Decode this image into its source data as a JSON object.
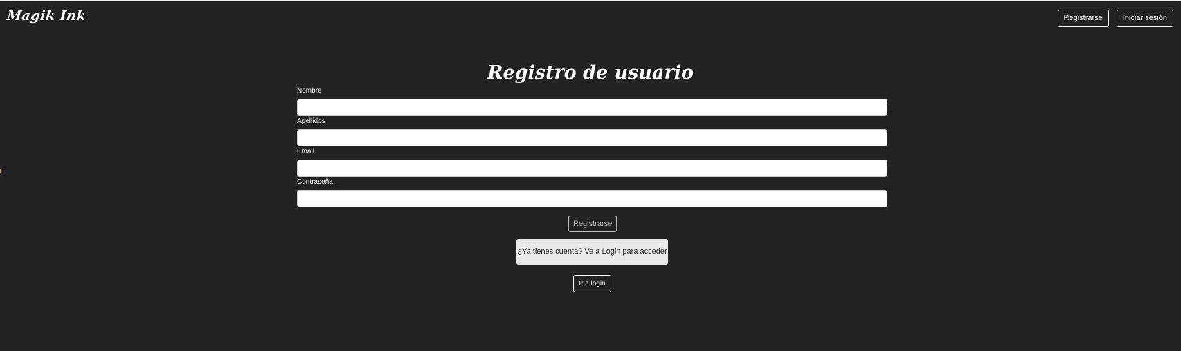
{
  "header": {
    "brand": "Magik Ink",
    "register_label": "Registrarse",
    "login_label": "Iniciar sesión"
  },
  "page": {
    "title": "Registro de usuario"
  },
  "form": {
    "fields": [
      {
        "label": "Nombre",
        "value": "",
        "placeholder": ""
      },
      {
        "label": "Apellidos",
        "value": "",
        "placeholder": ""
      },
      {
        "label": "Email",
        "value": "",
        "placeholder": ""
      },
      {
        "label": "Contraseña",
        "value": "",
        "placeholder": ""
      }
    ],
    "submit_label": "Registrarse"
  },
  "login_prompt": {
    "text": "¿Ya tienes cuenta? Ve a Login para acceder",
    "button_label": "Ir a login"
  },
  "colors": {
    "background": "#222222",
    "text": "#ffffff",
    "notice_background": "#e9e9e9"
  }
}
